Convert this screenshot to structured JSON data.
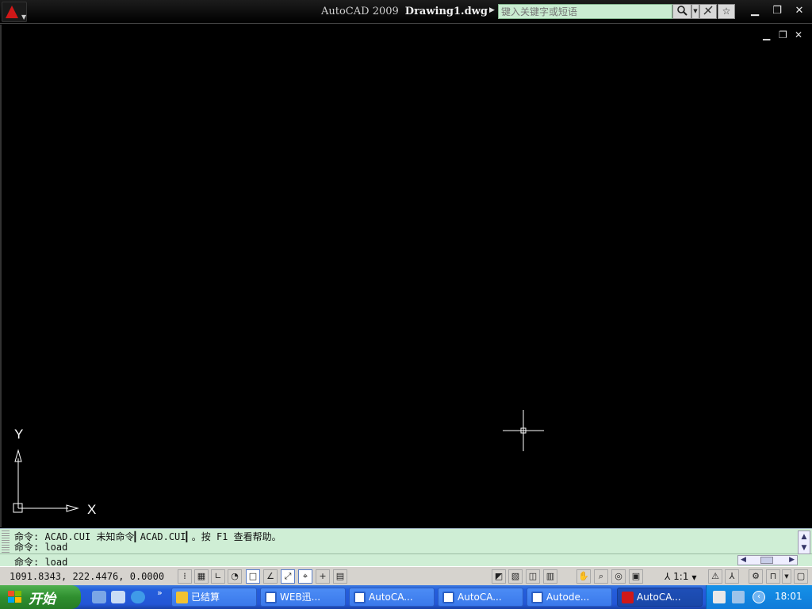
{
  "window": {
    "app_name": "AutoCAD 2009",
    "doc_name": "Drawing1.dwg",
    "search_placeholder": "键入关键字或短语",
    "minimize": "▁",
    "restore": "❐",
    "close": "✕"
  },
  "doc_controls": {
    "minimize": "▁",
    "restore": "❐",
    "close": "✕"
  },
  "ucs": {
    "x_label": "X",
    "y_label": "Y"
  },
  "command": {
    "history": [
      "命令: ACAD.CUI 未知命令▎ACAD.CUI▎。按 F1 查看帮助。",
      "命令: load"
    ],
    "current": "命令: load"
  },
  "status": {
    "coordinates": "1091.8343, 222.4476, 0.0000",
    "annotation_scale": "1:1"
  },
  "taskbar": {
    "start_label": "开始",
    "tasks": [
      {
        "label": "已结算",
        "icon": "folder-icon",
        "color": "#f1c232"
      },
      {
        "label": "WEB迅...",
        "icon": "word-icon",
        "color": "#2b5fc4"
      },
      {
        "label": "AutoCA...",
        "icon": "word-icon",
        "color": "#2b5fc4"
      },
      {
        "label": "AutoCA...",
        "icon": "word-icon",
        "color": "#2b5fc4"
      },
      {
        "label": "Autode...",
        "icon": "word-icon",
        "color": "#2b5fc4"
      },
      {
        "label": "AutoCA...",
        "icon": "autocad-icon",
        "color": "#d01818"
      }
    ],
    "clock": "18:01"
  },
  "colors": {
    "canvas_bg": "#000000",
    "command_bg": "#cfeed5",
    "taskbar_blue": "#245edc",
    "start_green": "#2f8f2f"
  }
}
